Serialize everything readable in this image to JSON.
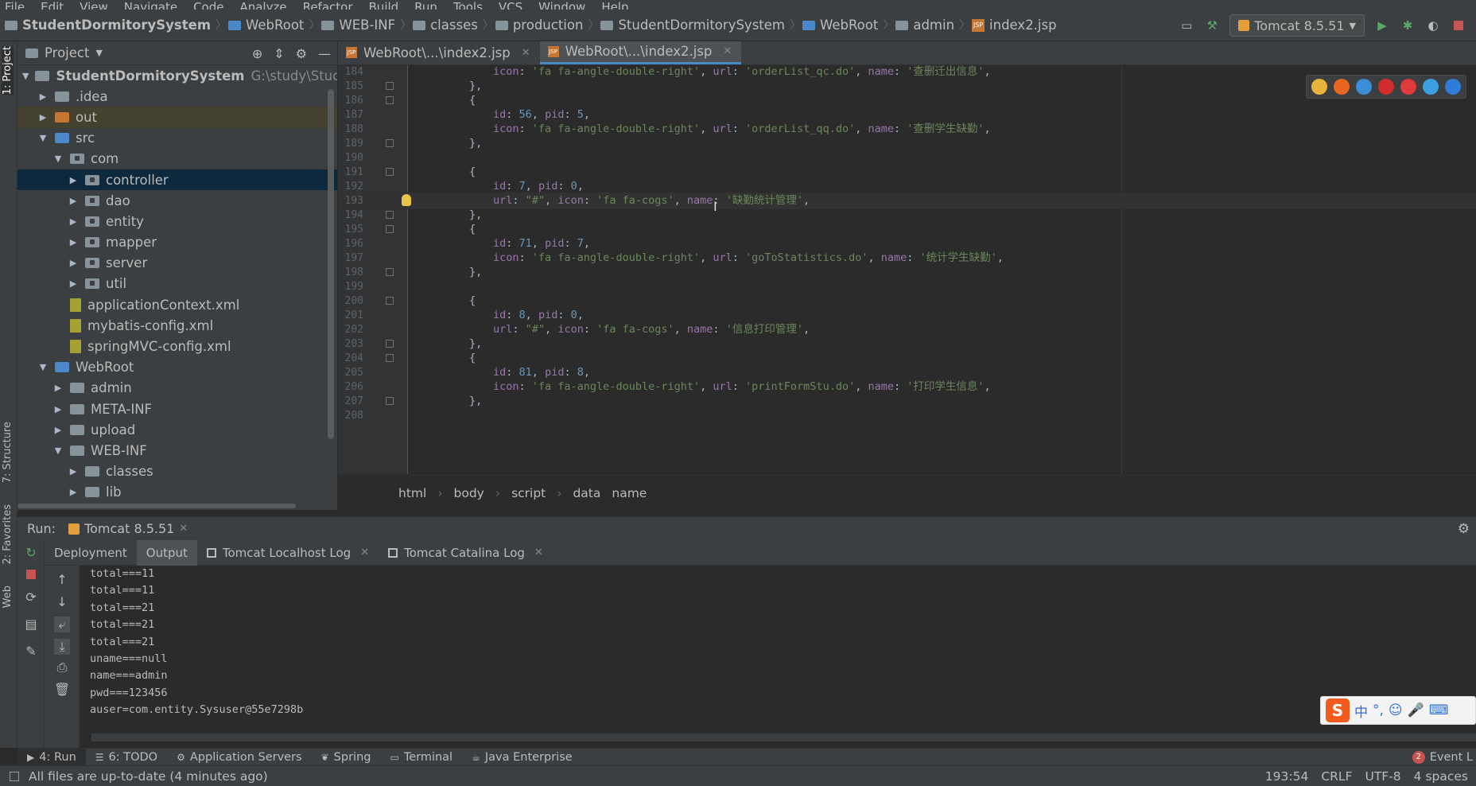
{
  "menu": [
    "File",
    "Edit",
    "View",
    "Navigate",
    "Code",
    "Analyze",
    "Refactor",
    "Build",
    "Run",
    "Tools",
    "VCS",
    "Window",
    "Help"
  ],
  "breadcrumbs": [
    "StudentDormitorySystem",
    "WebRoot",
    "WEB-INF",
    "classes",
    "production",
    "StudentDormitorySystem",
    "WebRoot",
    "admin",
    "index2.jsp"
  ],
  "run_config": "Tomcat 8.5.51",
  "project_panel": {
    "title": "Project",
    "tree": [
      {
        "label": "StudentDormitorySystem",
        "path": "G:\\study\\StudentDormitorySyst",
        "depth": 0,
        "arrow": "down",
        "icon": "folder",
        "bold": true
      },
      {
        "label": ".idea",
        "depth": 1,
        "arrow": "right",
        "icon": "folder"
      },
      {
        "label": "out",
        "depth": 1,
        "arrow": "right",
        "icon": "folder-orange",
        "highlight": true
      },
      {
        "label": "src",
        "depth": 1,
        "arrow": "down",
        "icon": "folder-blue"
      },
      {
        "label": "com",
        "depth": 2,
        "arrow": "down",
        "icon": "package"
      },
      {
        "label": "controller",
        "depth": 3,
        "arrow": "right",
        "icon": "package",
        "selected": true
      },
      {
        "label": "dao",
        "depth": 3,
        "arrow": "right",
        "icon": "package"
      },
      {
        "label": "entity",
        "depth": 3,
        "arrow": "right",
        "icon": "package"
      },
      {
        "label": "mapper",
        "depth": 3,
        "arrow": "right",
        "icon": "package"
      },
      {
        "label": "server",
        "depth": 3,
        "arrow": "right",
        "icon": "package"
      },
      {
        "label": "util",
        "depth": 3,
        "arrow": "right",
        "icon": "package"
      },
      {
        "label": "applicationContext.xml",
        "depth": 2,
        "arrow": "none",
        "icon": "xml"
      },
      {
        "label": "mybatis-config.xml",
        "depth": 2,
        "arrow": "none",
        "icon": "xml"
      },
      {
        "label": "springMVC-config.xml",
        "depth": 2,
        "arrow": "none",
        "icon": "xml"
      },
      {
        "label": "WebRoot",
        "depth": 1,
        "arrow": "down",
        "icon": "web-folder"
      },
      {
        "label": "admin",
        "depth": 2,
        "arrow": "right",
        "icon": "folder"
      },
      {
        "label": "META-INF",
        "depth": 2,
        "arrow": "right",
        "icon": "folder"
      },
      {
        "label": "upload",
        "depth": 2,
        "arrow": "right",
        "icon": "folder"
      },
      {
        "label": "WEB-INF",
        "depth": 2,
        "arrow": "down",
        "icon": "folder"
      },
      {
        "label": "classes",
        "depth": 3,
        "arrow": "right",
        "icon": "folder"
      },
      {
        "label": "lib",
        "depth": 3,
        "arrow": "right",
        "icon": "folder"
      }
    ]
  },
  "editor": {
    "tabs": [
      {
        "label": "WebRoot\\...\\index2.jsp",
        "active": false
      },
      {
        "label": "WebRoot\\...\\index2.jsp",
        "active": true
      }
    ],
    "lines": [
      {
        "num": "184",
        "tokens": [
          [
            "k",
            "icon"
          ],
          [
            "p",
            ": "
          ],
          [
            "s",
            "'fa fa-angle-double-right'"
          ],
          [
            "p",
            ", "
          ],
          [
            "k",
            "url"
          ],
          [
            "p",
            ": "
          ],
          [
            "s",
            "'orderList_qc.do'"
          ],
          [
            "p",
            ", "
          ],
          [
            "k",
            "name"
          ],
          [
            "p",
            ": "
          ],
          [
            "s",
            "'查删迁出信息'"
          ],
          [
            "p",
            ","
          ]
        ],
        "fold": false
      },
      {
        "num": "185",
        "tokens": [
          [
            "p",
            "},"
          ]
        ],
        "fold": true,
        "indent": 1
      },
      {
        "num": "186",
        "tokens": [
          [
            "p",
            "{"
          ]
        ],
        "fold": true,
        "indent": 1
      },
      {
        "num": "187",
        "tokens": [
          [
            "k",
            "id"
          ],
          [
            "p",
            ": "
          ],
          [
            "n",
            "56"
          ],
          [
            "p",
            ", "
          ],
          [
            "k",
            "pid"
          ],
          [
            "p",
            ": "
          ],
          [
            "n",
            "5"
          ],
          [
            "p",
            ","
          ]
        ],
        "fold": false
      },
      {
        "num": "188",
        "tokens": [
          [
            "k",
            "icon"
          ],
          [
            "p",
            ": "
          ],
          [
            "s",
            "'fa fa-angle-double-right'"
          ],
          [
            "p",
            ", "
          ],
          [
            "k",
            "url"
          ],
          [
            "p",
            ": "
          ],
          [
            "s",
            "'orderList_qq.do'"
          ],
          [
            "p",
            ", "
          ],
          [
            "k",
            "name"
          ],
          [
            "p",
            ": "
          ],
          [
            "s",
            "'查删学生缺勤'"
          ],
          [
            "p",
            ","
          ]
        ],
        "fold": false
      },
      {
        "num": "189",
        "tokens": [
          [
            "p",
            "},"
          ]
        ],
        "fold": true,
        "indent": 1
      },
      {
        "num": "190",
        "tokens": [],
        "fold": false
      },
      {
        "num": "191",
        "tokens": [
          [
            "p",
            "{"
          ]
        ],
        "fold": true,
        "indent": 1
      },
      {
        "num": "192",
        "tokens": [
          [
            "k",
            "id"
          ],
          [
            "p",
            ": "
          ],
          [
            "n",
            "7"
          ],
          [
            "p",
            ", "
          ],
          [
            "k",
            "pid"
          ],
          [
            "p",
            ": "
          ],
          [
            "n",
            "0"
          ],
          [
            "p",
            ","
          ]
        ],
        "fold": false
      },
      {
        "num": "193",
        "tokens": [
          [
            "k",
            "url"
          ],
          [
            "p",
            ": "
          ],
          [
            "s",
            "\"#\""
          ],
          [
            "p",
            ", "
          ],
          [
            "k",
            "icon"
          ],
          [
            "p",
            ": "
          ],
          [
            "s",
            "'fa fa-cogs'"
          ],
          [
            "p",
            ", "
          ],
          [
            "k",
            "name"
          ],
          [
            "p",
            ": "
          ],
          [
            "s",
            "'缺勤统计管理'"
          ],
          [
            "p",
            ","
          ]
        ],
        "fold": false,
        "current": true,
        "bulb": true
      },
      {
        "num": "194",
        "tokens": [
          [
            "p",
            "},"
          ]
        ],
        "fold": true,
        "indent": 1
      },
      {
        "num": "195",
        "tokens": [
          [
            "p",
            "{"
          ]
        ],
        "fold": true,
        "indent": 1
      },
      {
        "num": "196",
        "tokens": [
          [
            "k",
            "id"
          ],
          [
            "p",
            ": "
          ],
          [
            "n",
            "71"
          ],
          [
            "p",
            ", "
          ],
          [
            "k",
            "pid"
          ],
          [
            "p",
            ": "
          ],
          [
            "n",
            "7"
          ],
          [
            "p",
            ","
          ]
        ],
        "fold": false
      },
      {
        "num": "197",
        "tokens": [
          [
            "k",
            "icon"
          ],
          [
            "p",
            ": "
          ],
          [
            "s",
            "'fa fa-angle-double-right'"
          ],
          [
            "p",
            ", "
          ],
          [
            "k",
            "url"
          ],
          [
            "p",
            ": "
          ],
          [
            "s",
            "'goToStatistics.do'"
          ],
          [
            "p",
            ", "
          ],
          [
            "k",
            "name"
          ],
          [
            "p",
            ": "
          ],
          [
            "s",
            "'统计学生缺勤'"
          ],
          [
            "p",
            ","
          ]
        ],
        "fold": false
      },
      {
        "num": "198",
        "tokens": [
          [
            "p",
            "},"
          ]
        ],
        "fold": true,
        "indent": 1
      },
      {
        "num": "199",
        "tokens": [],
        "fold": false
      },
      {
        "num": "200",
        "tokens": [
          [
            "p",
            "{"
          ]
        ],
        "fold": true,
        "indent": 1
      },
      {
        "num": "201",
        "tokens": [
          [
            "k",
            "id"
          ],
          [
            "p",
            ": "
          ],
          [
            "n",
            "8"
          ],
          [
            "p",
            ", "
          ],
          [
            "k",
            "pid"
          ],
          [
            "p",
            ": "
          ],
          [
            "n",
            "0"
          ],
          [
            "p",
            ","
          ]
        ],
        "fold": false
      },
      {
        "num": "202",
        "tokens": [
          [
            "k",
            "url"
          ],
          [
            "p",
            ": "
          ],
          [
            "s",
            "\"#\""
          ],
          [
            "p",
            ", "
          ],
          [
            "k",
            "icon"
          ],
          [
            "p",
            ": "
          ],
          [
            "s",
            "'fa fa-cogs'"
          ],
          [
            "p",
            ", "
          ],
          [
            "k",
            "name"
          ],
          [
            "p",
            ": "
          ],
          [
            "s",
            "'信息打印管理'"
          ],
          [
            "p",
            ","
          ]
        ],
        "fold": false
      },
      {
        "num": "203",
        "tokens": [
          [
            "p",
            "},"
          ]
        ],
        "fold": true,
        "indent": 1
      },
      {
        "num": "204",
        "tokens": [
          [
            "p",
            "{"
          ]
        ],
        "fold": true,
        "indent": 1
      },
      {
        "num": "205",
        "tokens": [
          [
            "k",
            "id"
          ],
          [
            "p",
            ": "
          ],
          [
            "n",
            "81"
          ],
          [
            "p",
            ", "
          ],
          [
            "k",
            "pid"
          ],
          [
            "p",
            ": "
          ],
          [
            "n",
            "8"
          ],
          [
            "p",
            ","
          ]
        ],
        "fold": false
      },
      {
        "num": "206",
        "tokens": [
          [
            "k",
            "icon"
          ],
          [
            "p",
            ": "
          ],
          [
            "s",
            "'fa fa-angle-double-right'"
          ],
          [
            "p",
            ", "
          ],
          [
            "k",
            "url"
          ],
          [
            "p",
            ": "
          ],
          [
            "s",
            "'printFormStu.do'"
          ],
          [
            "p",
            ", "
          ],
          [
            "k",
            "name"
          ],
          [
            "p",
            ": "
          ],
          [
            "s",
            "'打印学生信息'"
          ],
          [
            "p",
            ","
          ]
        ],
        "fold": false
      },
      {
        "num": "207",
        "tokens": [
          [
            "p",
            "},"
          ]
        ],
        "fold": true,
        "indent": 1
      },
      {
        "num": "208",
        "tokens": [],
        "fold": false
      }
    ],
    "breadcrumb": [
      "html",
      "body",
      "script",
      "data",
      "name"
    ],
    "browsers": [
      {
        "name": "chrome-icon",
        "color": "#e8b53a"
      },
      {
        "name": "firefox-icon",
        "color": "#e8661f"
      },
      {
        "name": "safari-icon",
        "color": "#3a8fd8"
      },
      {
        "name": "opera-icon",
        "color": "#d22c2c"
      },
      {
        "name": "yandex-icon",
        "color": "#e03a3a"
      },
      {
        "name": "ie-icon",
        "color": "#3aa0e0"
      },
      {
        "name": "edge-icon",
        "color": "#2e7dd6"
      }
    ]
  },
  "run_panel": {
    "label": "Run:",
    "tab": "Tomcat 8.5.51",
    "subtabs": [
      "Deployment",
      "Output",
      "Tomcat Localhost Log",
      "Tomcat Catalina Log"
    ],
    "output": [
      "total===11",
      "total===11",
      "total===21",
      "total===21",
      "total===21",
      "uname===null",
      "name===admin",
      "pwd===123456",
      "auser=com.entity.Sysuser@55e7298b"
    ]
  },
  "side_tabs": [
    "1: Project",
    "7: Structure",
    "2: Favorites",
    "Web"
  ],
  "bottom_tools": [
    "4: Run",
    "6: TODO",
    "Application Servers",
    "Spring",
    "Terminal",
    "Java Enterprise"
  ],
  "event_log": {
    "count": "2",
    "label": "Event L"
  },
  "status": {
    "message": "All files are up-to-date (4 minutes ago)",
    "position": "193:54",
    "line_sep": "CRLF",
    "encoding": "UTF-8",
    "indent": "4 spaces"
  },
  "ime": {
    "label": "中"
  }
}
